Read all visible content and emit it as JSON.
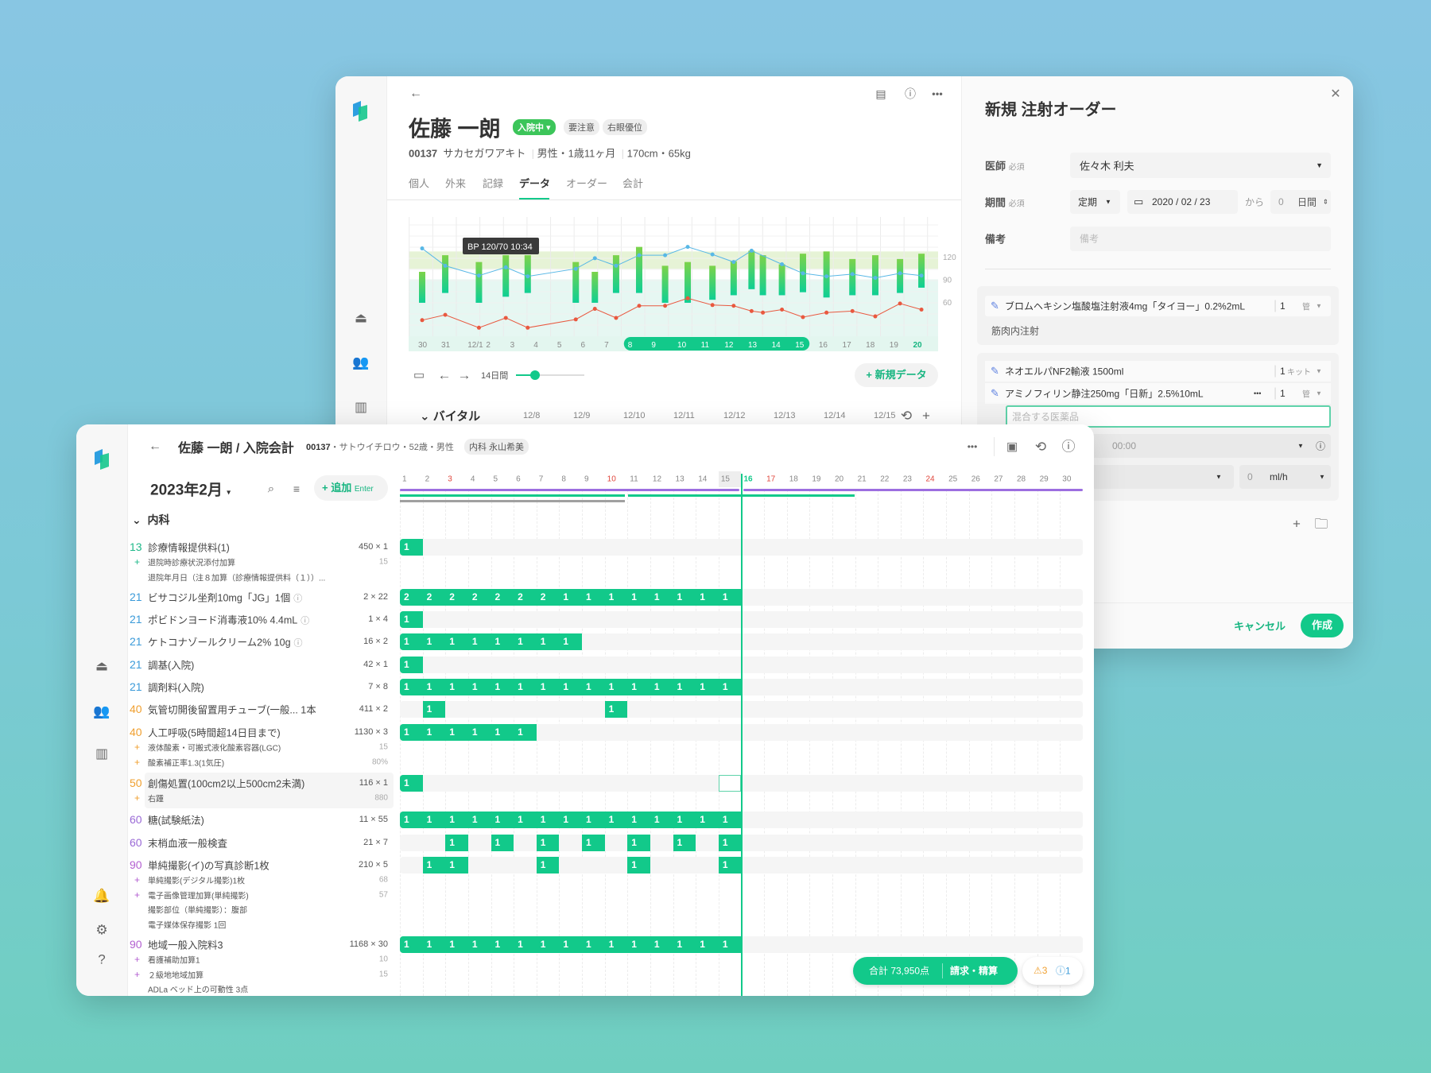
{
  "colors": {
    "accent": "#12c98a",
    "accent_text": "#16b580",
    "code_13": "#1fb98a",
    "code_21": "#3a9ad9",
    "code_40": "#f0a030",
    "code_50": "#f0a030",
    "code_60": "#9a6ad6",
    "code_90": "#b35fd1",
    "holiday": "#e0463c",
    "purple_bar": "#9c6ee0",
    "gray_bar": "#a0a0a0"
  },
  "back": {
    "sidebar": {
      "icons": [
        "bell-icon",
        "users-icon",
        "chart-icon"
      ]
    },
    "header": {
      "name": "佐藤 一朗",
      "status_badge": "入院中 ▾",
      "badges": [
        "要注意",
        "右眼優位"
      ],
      "patient_id": "00137",
      "kana": "サカセガワアキト",
      "sex_age": "男性・1歳11ヶ月",
      "body": "170cm・65kg",
      "actions": [
        "card-add-icon",
        "alert-icon",
        "more-icon"
      ]
    },
    "tabs": [
      "個人",
      "外来",
      "記録",
      "データ",
      "オーダー",
      "会計"
    ],
    "active_tab": "データ",
    "chart_data": {
      "type": "bar+line",
      "x_ticks": [
        "30",
        "31",
        "12/1",
        "2",
        "3",
        "4",
        "5",
        "6",
        "7",
        "8",
        "9",
        "10",
        "11",
        "12",
        "13",
        "14",
        "15",
        "16",
        "17",
        "18",
        "19",
        "20"
      ],
      "selected_ticks": [
        "8",
        "9",
        "10",
        "11",
        "12",
        "13",
        "14",
        "15"
      ],
      "current_tick": "20",
      "yticks": [
        120,
        90,
        60
      ],
      "ylim": [
        10,
        175
      ],
      "tooltip": {
        "label": "BP",
        "value": "120/70",
        "time": "10:34"
      },
      "bands": [
        {
          "from": 104,
          "to": 127,
          "color": "#e6f3d6"
        },
        {
          "from": 10,
          "to": 90,
          "color": "#e6f7f2"
        }
      ],
      "bars": {
        "x": [
          0,
          0.98,
          2.41,
          3.55,
          4.48,
          6.52,
          7.33,
          8.23,
          9.21,
          10.31,
          11.27,
          12.32,
          13.22,
          13.98,
          14.46,
          15.27,
          16.16,
          17.16,
          18.26,
          19.23,
          20.28,
          21.19
        ],
        "high": [
          100,
          122,
          113,
          122,
          122,
          113,
          100,
          122,
          133,
          108,
          113,
          108,
          114,
          128,
          122,
          110,
          124,
          127,
          117,
          122,
          117,
          124
        ],
        "low": [
          59,
          72,
          59,
          67,
          72,
          59,
          59,
          72,
          72,
          59,
          59,
          63,
          69,
          77,
          69,
          69,
          73,
          66,
          69,
          69,
          72,
          79
        ]
      },
      "series": [
        {
          "color": "#58b8e6",
          "x": [
            0,
            0.98,
            2.41,
            3.55,
            4.48,
            6.52,
            7.33,
            8.23,
            9.21,
            10.31,
            11.27,
            12.32,
            13.22,
            13.98,
            15.27,
            16.16,
            17.16,
            18.26,
            19.23,
            20.28,
            21.19
          ],
          "values": [
            131,
            108,
            95,
            106,
            94,
            104,
            118,
            108,
            122,
            122,
            133,
            123,
            113,
            128,
            110,
            98,
            94,
            97,
            92,
            98,
            95
          ]
        },
        {
          "color": "#e9583f",
          "x": [
            0,
            0.98,
            2.41,
            3.55,
            4.48,
            6.52,
            7.33,
            8.23,
            9.21,
            10.31,
            11.27,
            12.32,
            13.22,
            13.98,
            14.46,
            15.27,
            16.16,
            17.16,
            18.26,
            19.23,
            20.28,
            21.19
          ],
          "values": [
            36,
            43,
            26,
            39,
            26,
            37,
            51,
            39,
            55,
            55,
            65,
            56,
            55,
            48,
            46,
            50,
            40,
            46,
            48,
            41,
            58,
            50
          ]
        }
      ]
    },
    "controls": {
      "range_label": "14日間",
      "range_fraction": 0.25,
      "new_data": "+ 新規データ"
    },
    "vitals": {
      "label": "バイタル",
      "dates": [
        "12/8",
        "12/9",
        "12/10",
        "12/11",
        "12/12",
        "12/13",
        "12/14",
        "12/15"
      ]
    }
  },
  "drawer": {
    "title": "新規 注射オーダー",
    "required": "必須",
    "doctor": {
      "label": "医師",
      "value": "佐々木 利夫"
    },
    "period": {
      "label": "期間",
      "type": "定期",
      "date": "2020 / 02 / 23",
      "from": "から",
      "days": "0",
      "days_unit": "日間"
    },
    "note": {
      "label": "備考",
      "placeholder": "備考"
    },
    "orders": [
      {
        "drugs": [
          {
            "name": "ブロムヘキシン塩酸塩注射液4mg「タイヨー」0.2%2mL",
            "qty": "1",
            "unit": "管"
          }
        ],
        "route": "筋肉内注射"
      },
      {
        "drugs": [
          {
            "name": "ネオエルパNF2輸液 1500ml",
            "qty": "1",
            "unit": "キット"
          },
          {
            "name": "アミノフィリン静注250mg「日新」2.5%10mL",
            "qty": "1",
            "unit": "管",
            "more": "•••"
          }
        ],
        "mix_placeholder": "混合する医薬品",
        "time_label": "刻",
        "time": "00:00",
        "tech_label": "技",
        "rate": "0",
        "rate_unit": "ml/h"
      }
    ],
    "cancel": "キャンセル",
    "create": "作成"
  },
  "front": {
    "title": "佐藤 一朗 / 入院会計",
    "patient_id": "00137",
    "patient_info": "・サトウイチロウ・52歳・男性",
    "dept_badge": "内科 永山希美",
    "month": "2023年2月",
    "add_label": "追加",
    "add_hint": "Enter",
    "section": "内科",
    "days": [
      "1",
      "2",
      "3",
      "4",
      "5",
      "6",
      "7",
      "8",
      "9",
      "10",
      "11",
      "12",
      "13",
      "14",
      "15",
      "16",
      "17",
      "18",
      "19",
      "20",
      "21",
      "22",
      "23",
      "24",
      "25",
      "26",
      "27",
      "28",
      "29",
      "30"
    ],
    "holidays": [
      "3",
      "10",
      "17",
      "24"
    ],
    "today": "16",
    "items": [
      {
        "code": "13",
        "name": "診療情報提供料(1)",
        "qty": "450 × 1",
        "subs": [
          {
            "plus": true,
            "text": "退院時診療状況添付加算",
            "value": "15"
          },
          {
            "plus": false,
            "text": "退院年月日（注８加算（診療情報提供料（１））...",
            "value": ""
          }
        ],
        "cells": [
          1,
          null,
          null,
          null,
          null,
          null,
          null,
          null,
          null,
          null,
          null,
          null,
          null,
          null,
          null
        ]
      },
      {
        "code": "21",
        "name": "ビサコジル坐剤10mg「JG」1個",
        "info": true,
        "qty": "2 × 22",
        "subs": [],
        "cells": [
          2,
          2,
          2,
          2,
          2,
          2,
          2,
          1,
          1,
          1,
          1,
          1,
          1,
          1,
          1
        ]
      },
      {
        "code": "21",
        "name": "ポビドンヨード消毒液10% 4.4mL",
        "info": true,
        "qty": "1 × 4",
        "subs": [],
        "cells": [
          1,
          null,
          null,
          null,
          null,
          null,
          null,
          null,
          null,
          null,
          null,
          null,
          null,
          null,
          null
        ]
      },
      {
        "code": "21",
        "name": "ケトコナゾールクリーム2% 10g",
        "info": true,
        "qty": "16 × 2",
        "subs": [],
        "cells": [
          1,
          1,
          1,
          1,
          1,
          1,
          1,
          1,
          null,
          null,
          null,
          null,
          null,
          null,
          null
        ]
      },
      {
        "code": "21",
        "name": "調基(入院)",
        "qty": "42 × 1",
        "subs": [],
        "cells": [
          1,
          null,
          null,
          null,
          null,
          null,
          null,
          null,
          null,
          null,
          null,
          null,
          null,
          null,
          null
        ]
      },
      {
        "code": "21",
        "name": "調剤料(入院)",
        "qty": "7 × 8",
        "subs": [],
        "cells": [
          1,
          1,
          1,
          1,
          1,
          1,
          1,
          1,
          1,
          1,
          1,
          1,
          1,
          1,
          1
        ]
      },
      {
        "code": "40",
        "name": "気管切開後留置用チューブ(一般... 1本",
        "qty": "411 × 2",
        "subs": [],
        "cells": [
          null,
          1,
          null,
          null,
          null,
          null,
          null,
          null,
          null,
          1,
          null,
          null,
          null,
          null,
          null
        ]
      },
      {
        "code": "40",
        "name": "人工呼吸(5時間超14日目まで)",
        "qty": "1130 × 3",
        "subs": [
          {
            "plus": true,
            "text": "液体酸素・可搬式液化酸素容器(LGC)",
            "value": "15"
          },
          {
            "plus": true,
            "text": "酸素補正率1.3(1気圧)",
            "value": "80%"
          }
        ],
        "cells": [
          1,
          1,
          1,
          1,
          1,
          1,
          null,
          null,
          null,
          null,
          null,
          null,
          null,
          null,
          null
        ]
      },
      {
        "code": "50",
        "name": "創傷処置(100cm2以上500cm2未満)",
        "qty": "116 × 1",
        "highlight": true,
        "outlined_day": 15,
        "subs": [
          {
            "plus": true,
            "text": "右踵",
            "value": "880"
          }
        ],
        "cells": [
          1,
          null,
          null,
          null,
          null,
          null,
          null,
          null,
          null,
          null,
          null,
          null,
          null,
          null,
          null
        ]
      },
      {
        "code": "60",
        "name": "糖(試験紙法)",
        "qty": "11 × 55",
        "subs": [],
        "cells": [
          1,
          1,
          1,
          1,
          1,
          1,
          1,
          1,
          1,
          1,
          1,
          1,
          1,
          1,
          1
        ]
      },
      {
        "code": "60",
        "name": "末梢血液一般検査",
        "qty": "21 × 7",
        "subs": [],
        "cells": [
          null,
          null,
          1,
          null,
          1,
          null,
          1,
          null,
          1,
          null,
          1,
          null,
          1,
          null,
          1
        ]
      },
      {
        "code": "90",
        "name": "単純撮影(イ)の写真診断1枚",
        "qty": "210 × 5",
        "subs": [
          {
            "plus": true,
            "text": "単純撮影(デジタル撮影)1枚",
            "value": "68"
          },
          {
            "plus": true,
            "text": "電子画像管理加算(単純撮影)",
            "value": "57"
          },
          {
            "plus": false,
            "text": "撮影部位（単純撮影）：腹部",
            "value": ""
          },
          {
            "plus": false,
            "text": "電子媒体保存撮影 1回",
            "value": ""
          }
        ],
        "cells": [
          null,
          1,
          1,
          null,
          null,
          null,
          1,
          null,
          null,
          null,
          1,
          null,
          null,
          null,
          1
        ]
      },
      {
        "code": "90",
        "name": "地域一般入院料3",
        "qty": "1168 × 30",
        "subs": [
          {
            "plus": true,
            "text": "看護補助加算1",
            "value": "10"
          },
          {
            "plus": true,
            "text": "２級地地域加算",
            "value": "15"
          },
          {
            "plus": false,
            "text": "ADLa ベッド上の可動性 3点",
            "value": ""
          }
        ],
        "cells": [
          1,
          1,
          1,
          1,
          1,
          1,
          1,
          1,
          1,
          1,
          1,
          1,
          1,
          1,
          1
        ]
      }
    ],
    "total": "合計 73,950点",
    "bill": "請求・精算",
    "warnings": "3",
    "infos": "1"
  }
}
